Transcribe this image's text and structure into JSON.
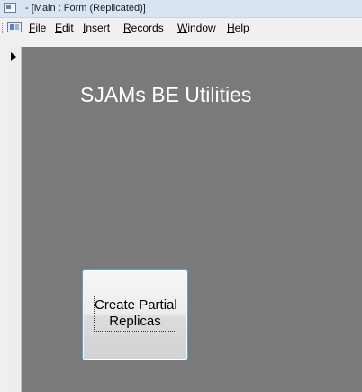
{
  "window": {
    "title": "- [Main : Form (Replicated)]"
  },
  "menu": {
    "items": [
      {
        "accel": "F",
        "rest": "ile"
      },
      {
        "accel": "E",
        "rest": "dit"
      },
      {
        "accel": "I",
        "rest": "nsert"
      },
      {
        "accel": "R",
        "rest": "ecords"
      },
      {
        "accel": "W",
        "rest": "indow"
      },
      {
        "accel": "H",
        "rest": "elp"
      }
    ]
  },
  "form": {
    "heading": "SJAMs BE Utilities",
    "button": {
      "line1": "Create Partial",
      "line2": "Replicas"
    }
  },
  "colors": {
    "form_background": "#7a7a7a",
    "heading_text": "#ffffff",
    "button_focus_border": "#4fa3d9"
  },
  "icons": {
    "app": "access-app-icon",
    "form": "form-view-icon",
    "record": "current-record-arrow-icon"
  }
}
